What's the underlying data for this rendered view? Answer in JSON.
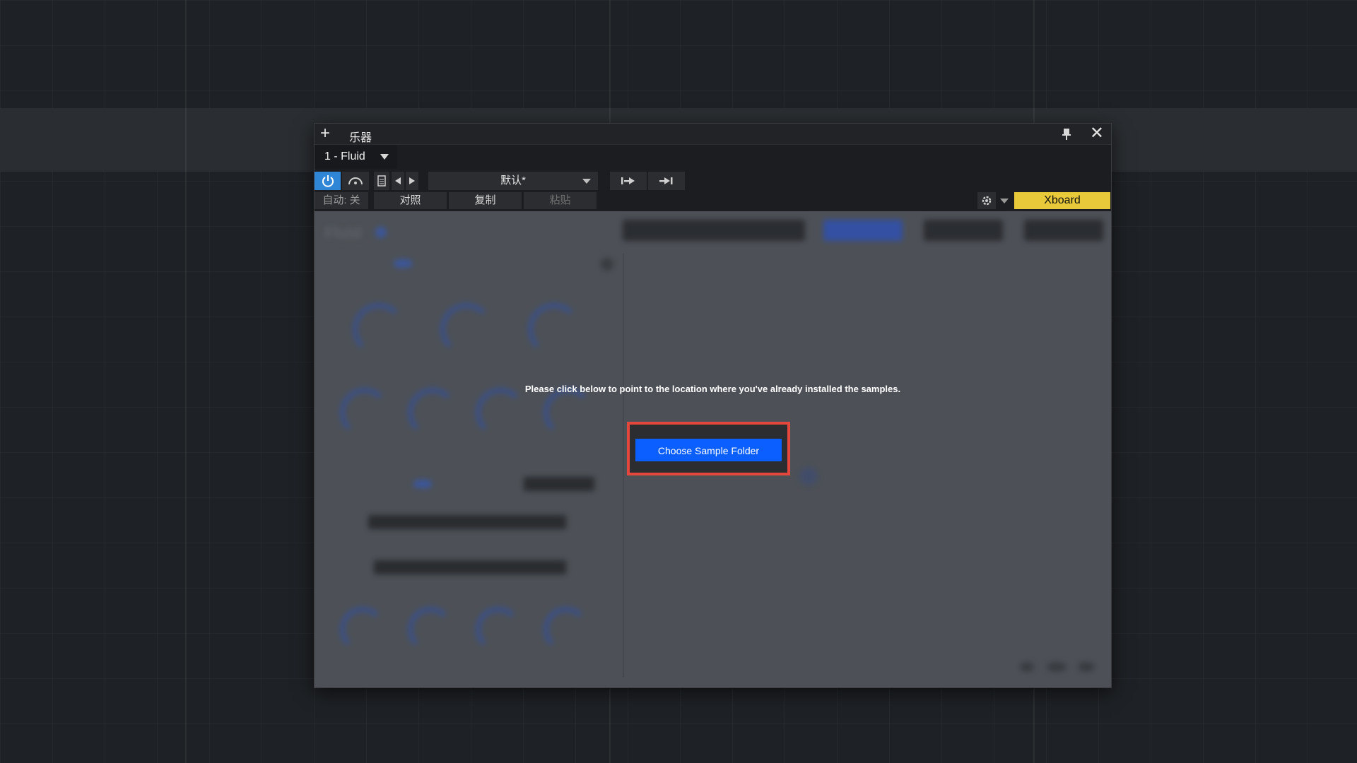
{
  "window": {
    "title": "乐器",
    "instrument_selector": "1 - Fluid"
  },
  "toolbar": {
    "preset_name": "默认*",
    "auto_label": "自动: 关",
    "compare_label": "对照",
    "copy_label": "复制",
    "paste_label": "粘贴",
    "xboard_label": "Xboard"
  },
  "plugin": {
    "message": "Please click below to point to the location where you've already installed the samples.",
    "choose_button": "Choose Sample Folder"
  },
  "colors": {
    "power_active": "#2f86d6",
    "xboard_bg": "#e8c93a",
    "cta_bg": "#0b5fff",
    "highlight_frame": "#e5473c"
  },
  "icons": [
    "plus-icon",
    "pin-icon",
    "close-icon",
    "power-icon",
    "arc-icon",
    "document-icon",
    "prev-arrow-icon",
    "next-arrow-icon",
    "skip-forward-icon",
    "skip-end-icon",
    "gear-icon",
    "chevron-down-icon"
  ]
}
